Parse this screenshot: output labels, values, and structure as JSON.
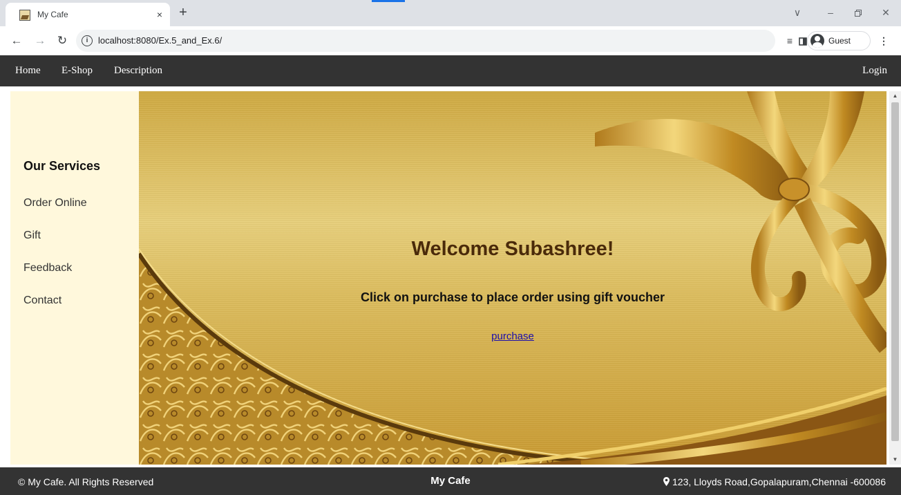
{
  "browser": {
    "tab_title": "My Cafe",
    "tab_close": "×",
    "new_tab": "+",
    "url": "localhost:8080/Ex.5_and_Ex.6/",
    "profile_label": "Guest",
    "icons": {
      "back": "back-arrow-icon",
      "forward": "forward-arrow-icon",
      "reload": "reload-icon",
      "site_info": "info-icon",
      "reading_list": "reading-list-icon",
      "side_panel": "side-panel-icon",
      "profile": "profile-icon",
      "menu": "kebab-menu-icon"
    }
  },
  "nav": {
    "home": "Home",
    "eshop": "E-Shop",
    "description": "Description",
    "login": "Login"
  },
  "sidebar": {
    "heading": "Our Services",
    "items": [
      {
        "label": "Order Online"
      },
      {
        "label": "Gift"
      },
      {
        "label": "Feedback"
      },
      {
        "label": "Contact"
      }
    ]
  },
  "hero": {
    "title": "Welcome Subashree!",
    "subtitle": "Click on purchase to place order using gift voucher",
    "link_label": "purchase"
  },
  "footer": {
    "copyright": "© My Cafe. All Rights Reserved",
    "brand": "My Cafe",
    "address": "123, Lloyds Road,Gopalapuram,Chennai -600086"
  },
  "colors": {
    "navbar_bg": "#333333",
    "sidebar_bg": "#fff8dc",
    "hero_gold": "#d9b655",
    "title_brown": "#4a2a0a",
    "link_blue": "#1a0dab"
  }
}
